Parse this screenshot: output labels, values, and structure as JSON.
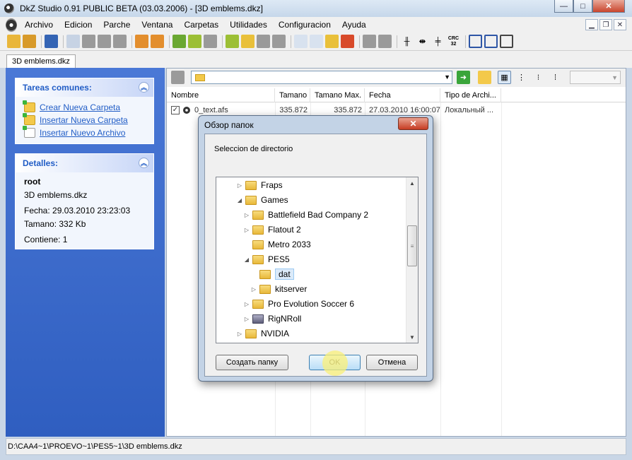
{
  "window": {
    "title": "DkZ Studio 0.91 PUBLIC BETA (03.03.2006)  - [3D emblems.dkz]",
    "min_label": "—",
    "max_label": "□",
    "close_label": "✕"
  },
  "menu": [
    {
      "label": "Archivo"
    },
    {
      "label": "Edicion"
    },
    {
      "label": "Parche"
    },
    {
      "label": "Ventana"
    },
    {
      "label": "Carpetas"
    },
    {
      "label": "Utilidades"
    },
    {
      "label": "Configuracion"
    },
    {
      "label": "Ayuda"
    }
  ],
  "mdi": {
    "min": "▁",
    "restore": "❐",
    "close": "✕"
  },
  "toolbar": {
    "crc_label": "CRC 32"
  },
  "tab": {
    "label": "3D emblems.dkz"
  },
  "tasks": {
    "title": "Tareas comunes:",
    "items": [
      {
        "label": "Crear Nueva Carpeta"
      },
      {
        "label": "Insertar Nueva Carpeta"
      },
      {
        "label": "Insertar Nuevo Archivo"
      }
    ]
  },
  "details": {
    "title": "Detalles:",
    "name": "root",
    "file": "3D emblems.dkz",
    "date": "Fecha: 29.03.2010 23:23:03",
    "size": "Tamano: 332 Kb",
    "contains": "Contiene: 1"
  },
  "columns": [
    {
      "label": "Nombre"
    },
    {
      "label": "Tamano"
    },
    {
      "label": "Tamano Max."
    },
    {
      "label": "Fecha"
    },
    {
      "label": "Tipo de Archi..."
    }
  ],
  "files": [
    {
      "name": "0_text.afs",
      "size": "335.872",
      "max": "335.872",
      "date": "27.03.2010 16:00:07",
      "type": "Локальный ..."
    }
  ],
  "status": {
    "path": "D:\\CAA4~1\\PROEVO~1\\PES5~1\\3D emblems.dkz"
  },
  "dialog": {
    "title": "Обзор папок",
    "close": "✕",
    "prompt": "Seleccion de directorio",
    "tree": [
      {
        "label": "Fraps"
      },
      {
        "label": "Games"
      },
      {
        "label": "Battlefield Bad Company 2"
      },
      {
        "label": "Flatout 2"
      },
      {
        "label": "Metro 2033"
      },
      {
        "label": "PES5"
      },
      {
        "label": "dat"
      },
      {
        "label": "kitserver"
      },
      {
        "label": "Pro Evolution Soccer 6"
      },
      {
        "label": "RigNRoll"
      },
      {
        "label": "NVIDIA"
      }
    ],
    "buttons": {
      "new_folder": "Создать папку",
      "ok": "OK",
      "cancel": "Отмена"
    }
  }
}
